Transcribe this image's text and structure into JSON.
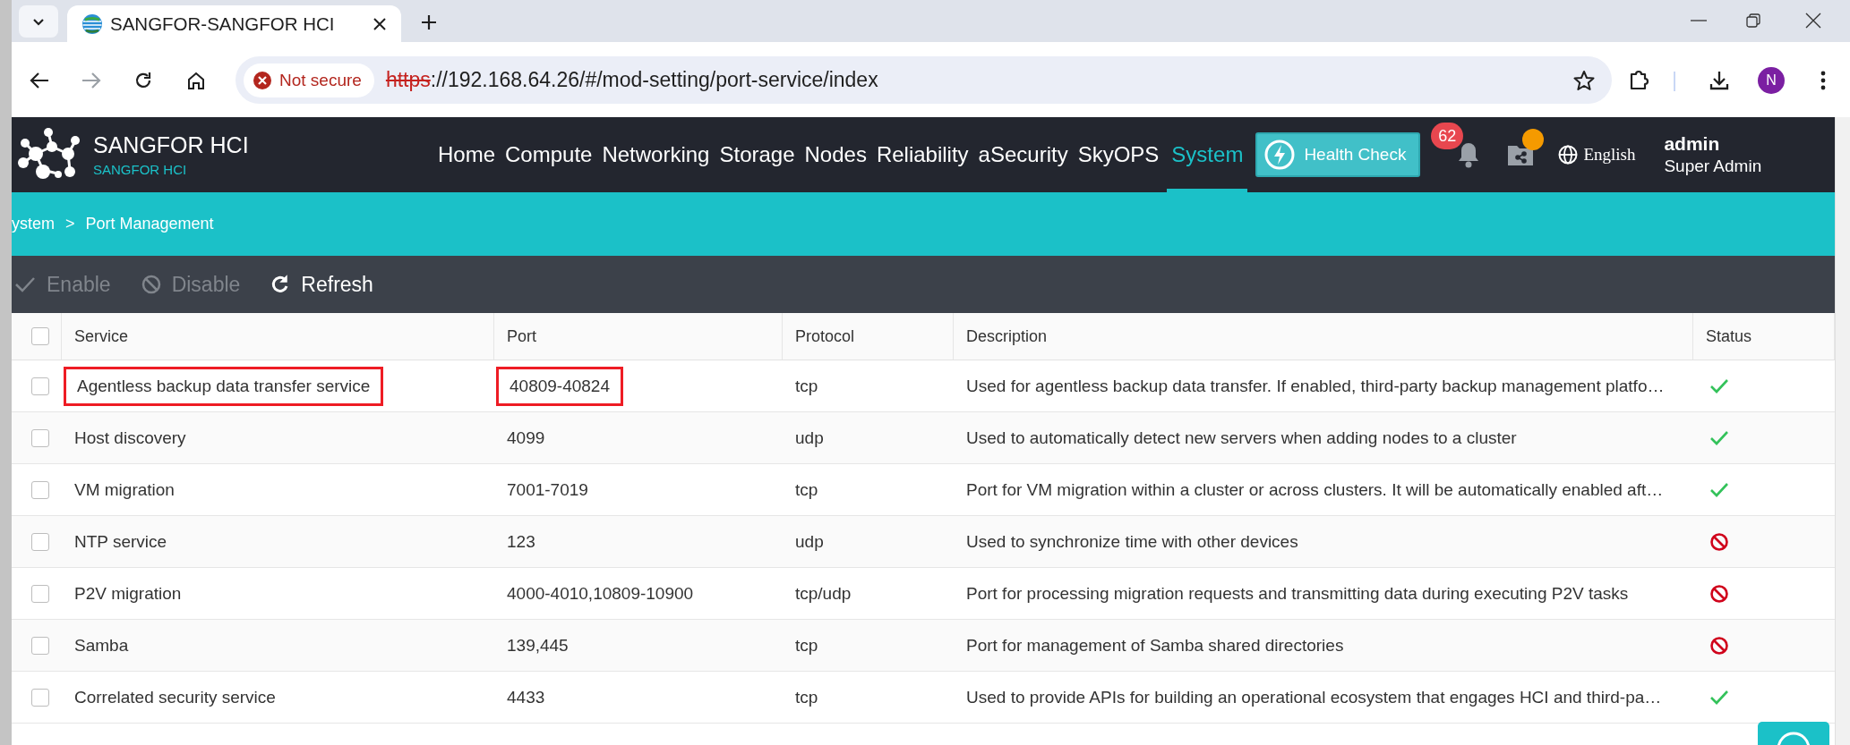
{
  "browser": {
    "tab_title": "SANGFOR-SANGFOR HCI",
    "security_label": "Not secure",
    "url_scheme": "https",
    "url_rest": "://192.168.64.26/#/mod-setting/port-service/index",
    "profile_initial": "N"
  },
  "app": {
    "product_name": "SANGFOR HCI",
    "product_subtitle": "SANGFOR HCI",
    "nav": [
      {
        "label": "Home",
        "selected": false
      },
      {
        "label": "Compute",
        "selected": false
      },
      {
        "label": "Networking",
        "selected": false
      },
      {
        "label": "Storage",
        "selected": false
      },
      {
        "label": "Nodes",
        "selected": false
      },
      {
        "label": "Reliability",
        "selected": false
      },
      {
        "label": "aSecurity",
        "selected": false
      },
      {
        "label": "SkyOPS",
        "selected": false
      },
      {
        "label": "System",
        "selected": true
      }
    ],
    "health_check": "Health Check",
    "notification_count": "62",
    "share_alert": true,
    "language": "English",
    "user_name": "admin",
    "user_role": "Super Admin"
  },
  "breadcrumb": {
    "items": [
      "ystem",
      "Port Management"
    ],
    "separator": ">"
  },
  "toolbar": [
    {
      "kind": "enable",
      "label": "Enable",
      "disabled": true
    },
    {
      "kind": "disable",
      "label": "Disable",
      "disabled": true
    },
    {
      "kind": "refresh",
      "label": "Refresh",
      "disabled": false
    }
  ],
  "table": {
    "select_all_checked": false,
    "columns": [
      "Service",
      "Port",
      "Protocol",
      "Description",
      "Status"
    ],
    "rows": [
      {
        "checked": false,
        "highlighted": true,
        "service": "Agentless backup data transfer service",
        "port": "40809-40824",
        "protocol": "tcp",
        "description": "Used for agentless backup data transfer. If enabled, third-party backup management platfo…",
        "enabled": true
      },
      {
        "checked": false,
        "highlighted": false,
        "service": "Host discovery",
        "port": "4099",
        "protocol": "udp",
        "description": "Used to automatically detect new servers when adding nodes to a cluster",
        "enabled": true
      },
      {
        "checked": false,
        "highlighted": false,
        "service": "VM migration",
        "port": "7001-7019",
        "protocol": "tcp",
        "description": "Port for VM migration within a cluster or across clusters. It will be automatically enabled aft…",
        "enabled": true
      },
      {
        "checked": false,
        "highlighted": false,
        "service": "NTP service",
        "port": "123",
        "protocol": "udp",
        "description": "Used to synchronize time with other devices",
        "enabled": false
      },
      {
        "checked": false,
        "highlighted": false,
        "service": "P2V migration",
        "port": "4000-4010,10809-10900",
        "protocol": "tcp/udp",
        "description": "Port for processing migration requests and transmitting data during executing P2V tasks",
        "enabled": false
      },
      {
        "checked": false,
        "highlighted": false,
        "service": "Samba",
        "port": "139,445",
        "protocol": "tcp",
        "description": "Port for management of Samba shared directories",
        "enabled": false
      },
      {
        "checked": false,
        "highlighted": false,
        "service": "Correlated security service",
        "port": "4433",
        "protocol": "tcp",
        "description": "Used to provide APIs for building an operational ecosystem that engages HCI and third-pa…",
        "enabled": true
      }
    ]
  }
}
